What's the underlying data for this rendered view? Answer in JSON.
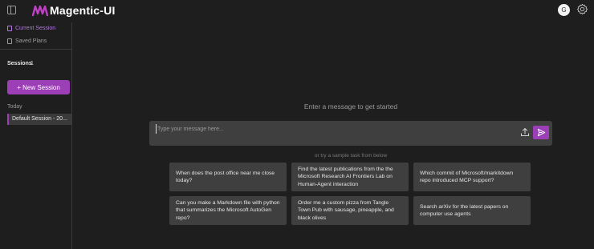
{
  "app": {
    "title": "Magentic-UI",
    "accent": "#9c3fb7"
  },
  "user": {
    "avatar_initial": "G"
  },
  "sidebar": {
    "nav": [
      {
        "label": "Current Session",
        "icon": "chat-icon",
        "active": true
      },
      {
        "label": "Saved Plans",
        "icon": "document-icon",
        "active": false
      }
    ],
    "sessions_label": "Sessions",
    "sessions_count": "1",
    "new_session_label": "+ New Session",
    "group_label": "Today",
    "sessions": [
      {
        "label": "Default Session - 20..."
      }
    ]
  },
  "main": {
    "prompt": "Enter a message to get started",
    "input_placeholder": "Type your message here...",
    "sample_hint": "or try a sample task from below",
    "samples": [
      "When does the post office near me close today?",
      "Find the latest publications from the the Microsoft Research AI Frontiers Lab on Human-Agent interaction",
      "Which commit of Microsoft/markitdown repo introduced MCP support?",
      "Can you make a Markdown file with python that summarizes the Microsoft AutoGen repo?",
      "Order me a custom pizza from Tangle Town Pub with sausage, pineapple, and black olives",
      "Search arXiv for the latest papers on computer use agents"
    ]
  }
}
